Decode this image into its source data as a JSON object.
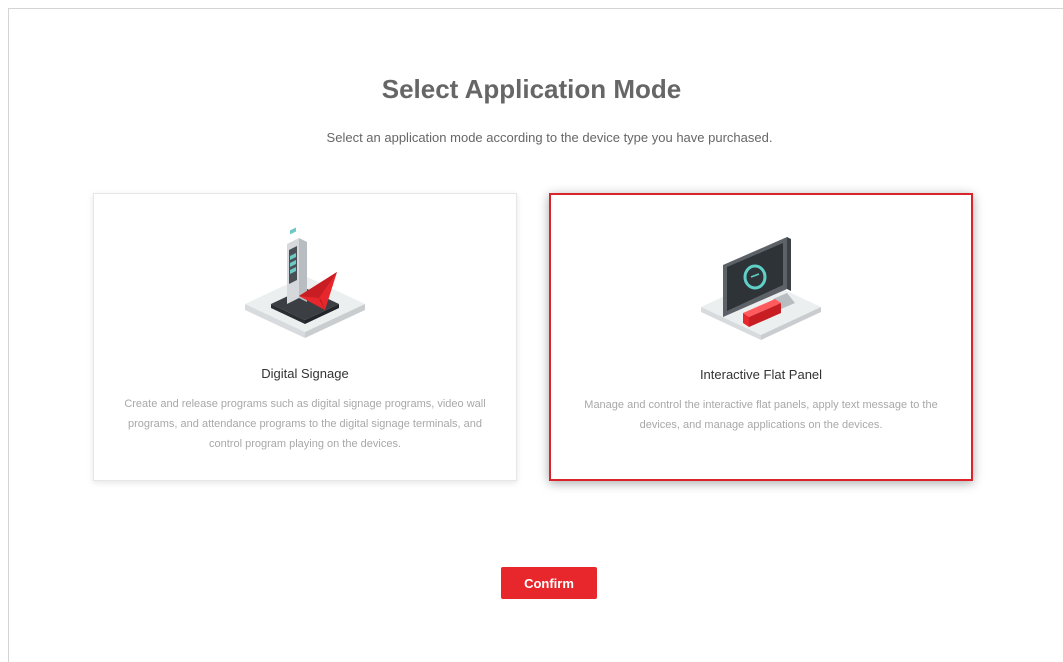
{
  "header": {
    "title": "Select Application Mode",
    "subtitle": "Select an application mode according to the device type you have purchased."
  },
  "modes": [
    {
      "name": "Digital Signage",
      "description": "Create and release programs such as digital signage programs, video wall programs, and attendance programs to the digital signage terminals, and control program playing on the devices.",
      "icon": "digital-signage-icon",
      "selected": false
    },
    {
      "name": "Interactive Flat Panel",
      "description": "Manage and control the interactive flat panels, apply text message to the devices, and manage applications on the devices.",
      "icon": "interactive-flat-panel-icon",
      "selected": true
    }
  ],
  "footer": {
    "confirm_label": "Confirm"
  },
  "colors": {
    "accent": "#e8272d",
    "selected_border": "#d9242b",
    "title_text": "#666666",
    "description_text": "#a8a8a8"
  }
}
